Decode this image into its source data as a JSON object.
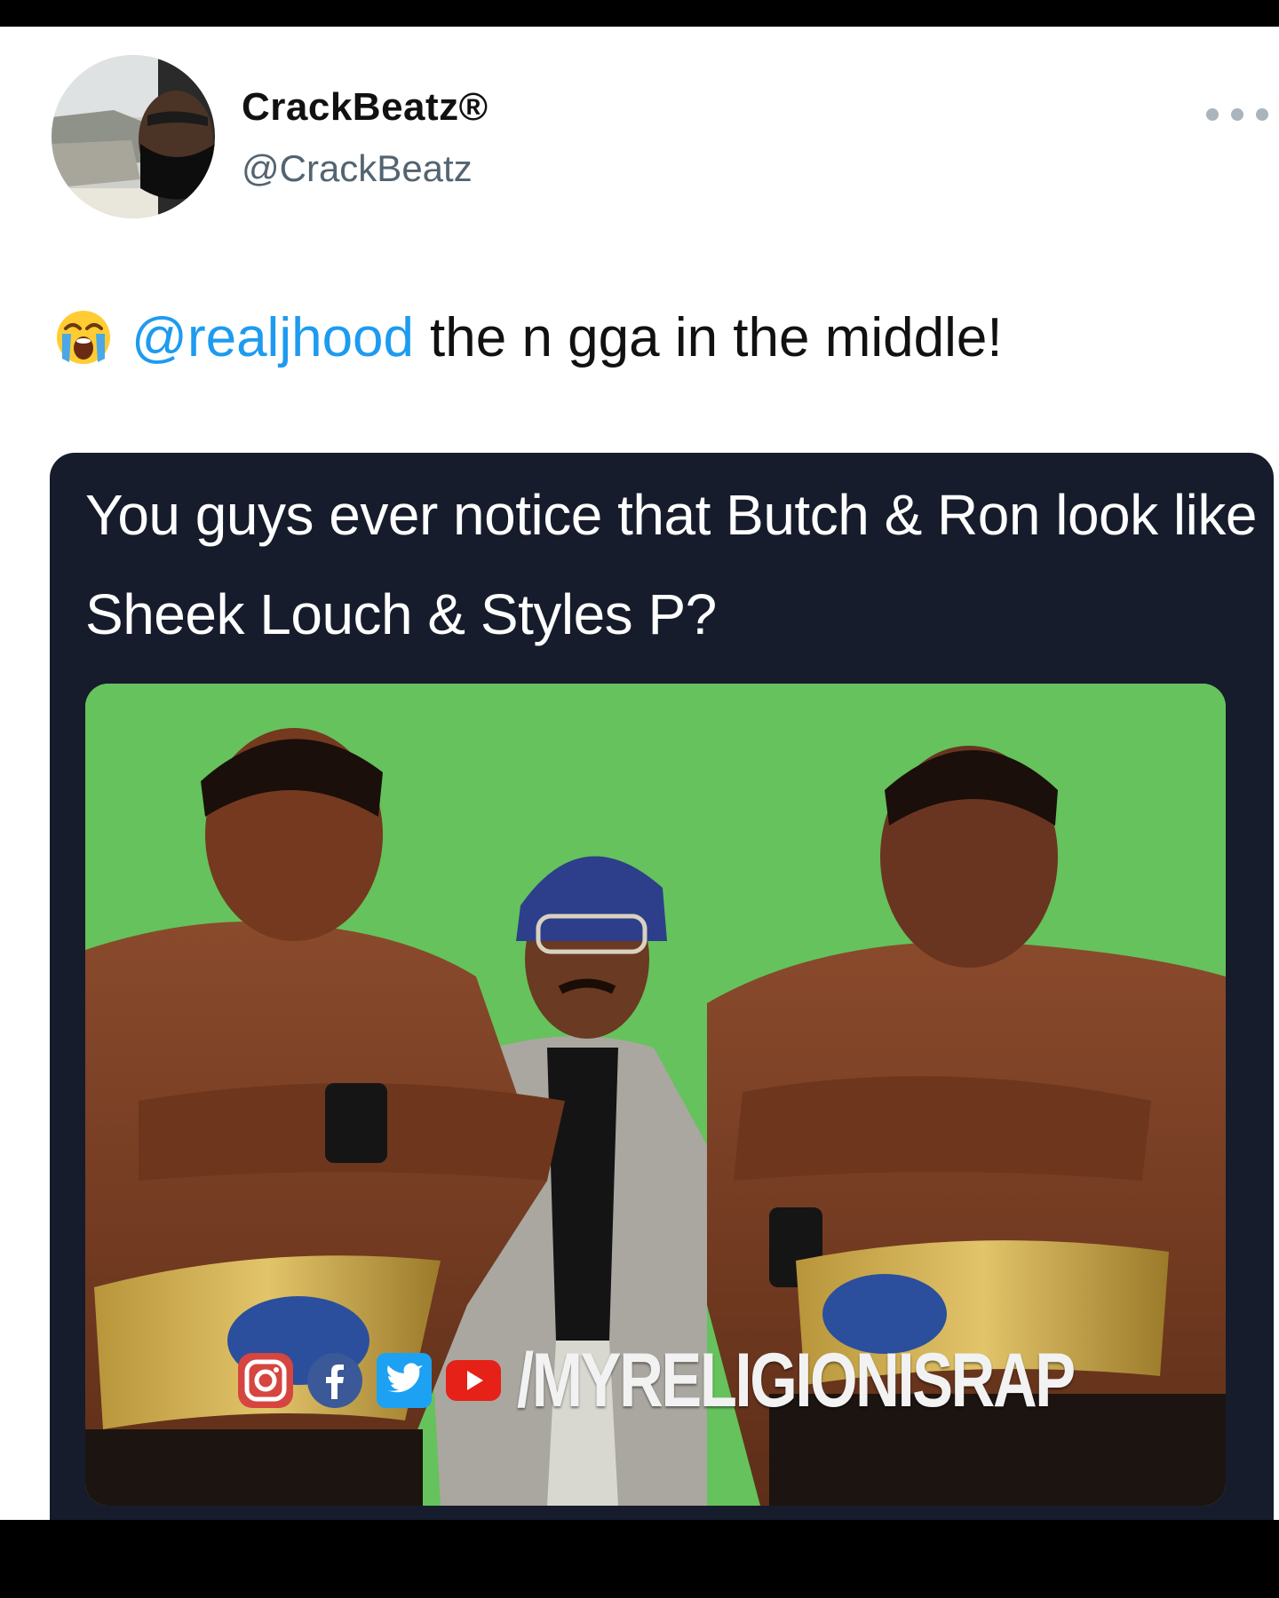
{
  "user": {
    "display_name": "CrackBeatz®",
    "handle": "@CrackBeatz",
    "avatar_icon": "person-avatar-photo"
  },
  "tweet": {
    "emoji_icon": "loudly-crying-face-icon",
    "mention": "@realjhood",
    "text": "the n gga in the middle!"
  },
  "media": {
    "caption": "You guys ever notice that Butch & Ron look like Sheek Louch & Styles P?",
    "photo_background_color": "#66c25c",
    "watermark": {
      "icons": [
        "instagram-icon",
        "facebook-icon",
        "twitter-icon",
        "youtube-icon"
      ],
      "text": "/MYRELIGIONISRAP"
    }
  },
  "colors": {
    "mention_blue": "#1d9bf0",
    "card_background": "#161c2b",
    "handle_gray": "#536471"
  }
}
